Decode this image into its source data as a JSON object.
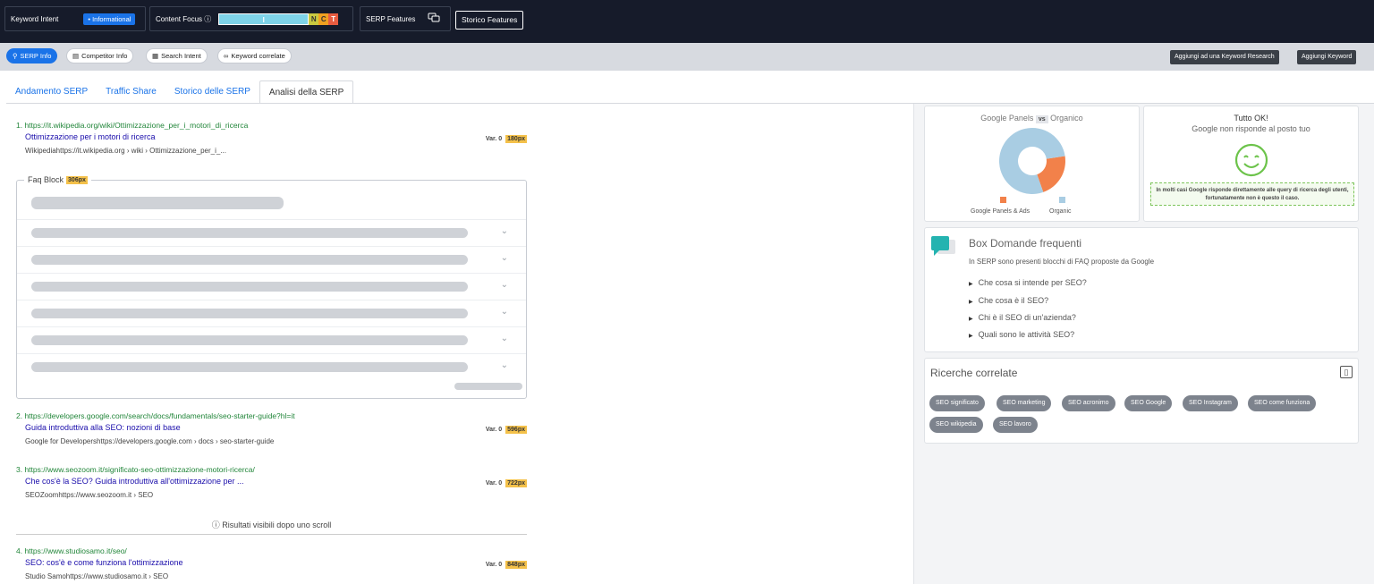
{
  "topbar": {
    "keyword_intent_label": "Keyword Intent",
    "intent_value": "• Informational",
    "content_focus_label": "Content Focus ⓘ",
    "focus_letters": [
      "I",
      "N",
      "C",
      "T"
    ],
    "serp_features_label": "SERP Features",
    "storico_features": "Storico Features"
  },
  "subbar": {
    "chips": [
      "SERP Info",
      "Competitor Info",
      "Search Intent",
      "Keyword correlate"
    ],
    "add_research": "Aggiungi ad una Keyword Research",
    "add_keyword": "Aggiungi Keyword"
  },
  "tabs": [
    "Andamento SERP",
    "Traffic Share",
    "Storico delle SERP",
    "Analisi della SERP"
  ],
  "results": [
    {
      "url": "1. https://it.wikipedia.org/wiki/Ottimizzazione_per_i_motori_di_ricerca",
      "title": "Ottimizzazione per i motori di ricerca",
      "crumb": "Wikipediahttps://it.wikipedia.org › wiki › Ottimizzazione_per_i_...",
      "var": "Var. 0",
      "px": "180px"
    },
    {
      "url": "2. https://developers.google.com/search/docs/fundamentals/seo-starter-guide?hl=it",
      "title": "Guida introduttiva alla SEO: nozioni di base",
      "crumb": "Google for Developershttps://developers.google.com › docs › seo-starter-guide",
      "var": "Var. 0",
      "px": "596px"
    },
    {
      "url": "3. https://www.seozoom.it/significato-seo-ottimizzazione-motori-ricerca/",
      "title": "Che cos'è la SEO? Guida introduttiva all'ottimizzazione per ...",
      "crumb": "SEOZoomhttps://www.seozoom.it › SEO",
      "var": "Var. 0",
      "px": "722px"
    },
    {
      "url": "4. https://www.studiosamo.it/seo/",
      "title": "SEO: cos'è e come funziona l'ottimizzazione",
      "crumb": "Studio Samohttps://www.studiosamo.it › SEO",
      "var": "Var. 0",
      "px": "848px"
    }
  ],
  "faq_block": {
    "label": "Faq Block",
    "px": "306px"
  },
  "scroll_note": "ⓘ Risultati visibili dopo uno scroll",
  "panels": {
    "title_left": "Google Panels",
    "vs": "vs",
    "title_right": "Organico",
    "legend_panels": "Google Panels & Ads",
    "legend_organic": "Organic",
    "share_panels": 0.22,
    "color_panels": "#f2814a",
    "color_organic": "#a9cde3"
  },
  "ok": {
    "title": "Tutto OK!",
    "subtitle": "Google non risponde al posto tuo",
    "note": "In molti casi Google risponde direttamente alle query di ricerca degli utenti, fortunatamente non è questo il caso."
  },
  "faq_box": {
    "title": "Box Domande frequenti",
    "desc": "In SERP sono presenti blocchi di FAQ proposte da Google",
    "questions": [
      "Che cosa si intende per SEO?",
      "Che cosa è il SEO?",
      "Chi è il SEO di un'azienda?",
      "Quali sono le attività SEO?"
    ]
  },
  "related": {
    "title": "Ricerche correlate",
    "tags": [
      "SEO significato",
      "SEO marketing",
      "SEO acronimo",
      "SEO Google",
      "SEO Instagram",
      "SEO come funziona",
      "SEO wikipedia",
      "SEO lavoro"
    ]
  }
}
